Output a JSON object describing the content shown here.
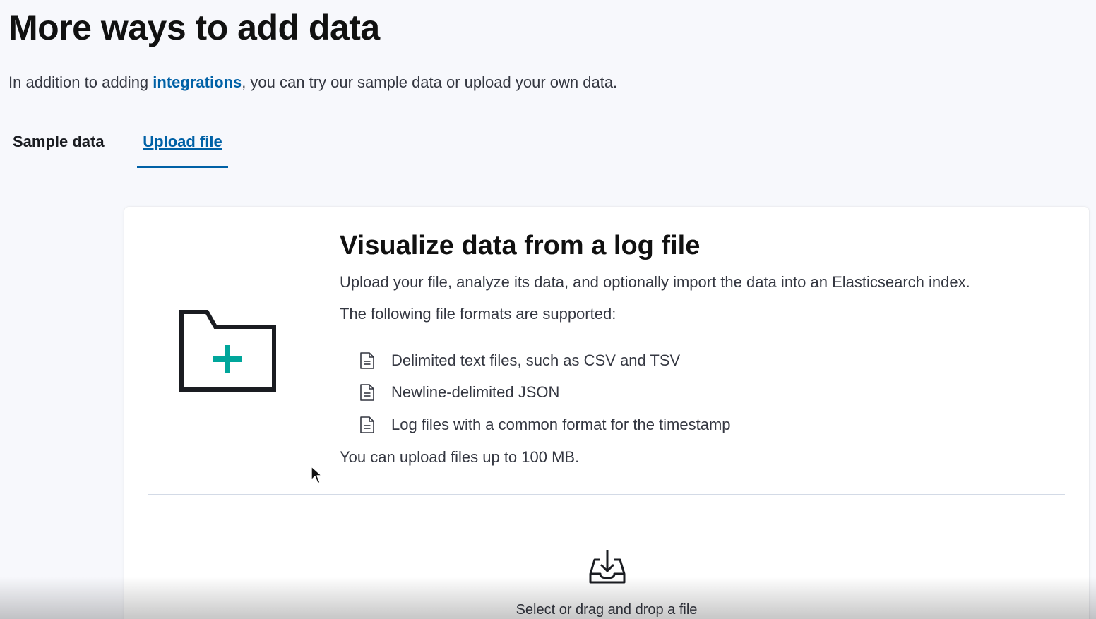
{
  "header": {
    "title": "More ways to add data",
    "intro_before": "In addition to adding ",
    "intro_link": "integrations",
    "intro_after": ", you can try our sample data or upload your own data."
  },
  "tabs": [
    {
      "label": "Sample data",
      "selected": false
    },
    {
      "label": "Upload file",
      "selected": true
    }
  ],
  "upload_panel": {
    "title": "Visualize data from a log file",
    "description": "Upload your file, analyze its data, and optionally import the data into an Elasticsearch index.",
    "formats_intro": "The following file formats are supported:",
    "formats": [
      "Delimited text files, such as CSV and TSV",
      "Newline-delimited JSON",
      "Log files with a common format for the timestamp"
    ],
    "size_limit": "You can upload files up to 100 MB.",
    "dropzone_label": "Select or drag and drop a file"
  },
  "icons": {
    "folder": "folder-add-icon",
    "document": "document-icon",
    "upload": "upload-tray-icon"
  },
  "colors": {
    "accent": "#0061a6",
    "plus": "#00a69b",
    "page_bg": "#f7f8fc"
  }
}
